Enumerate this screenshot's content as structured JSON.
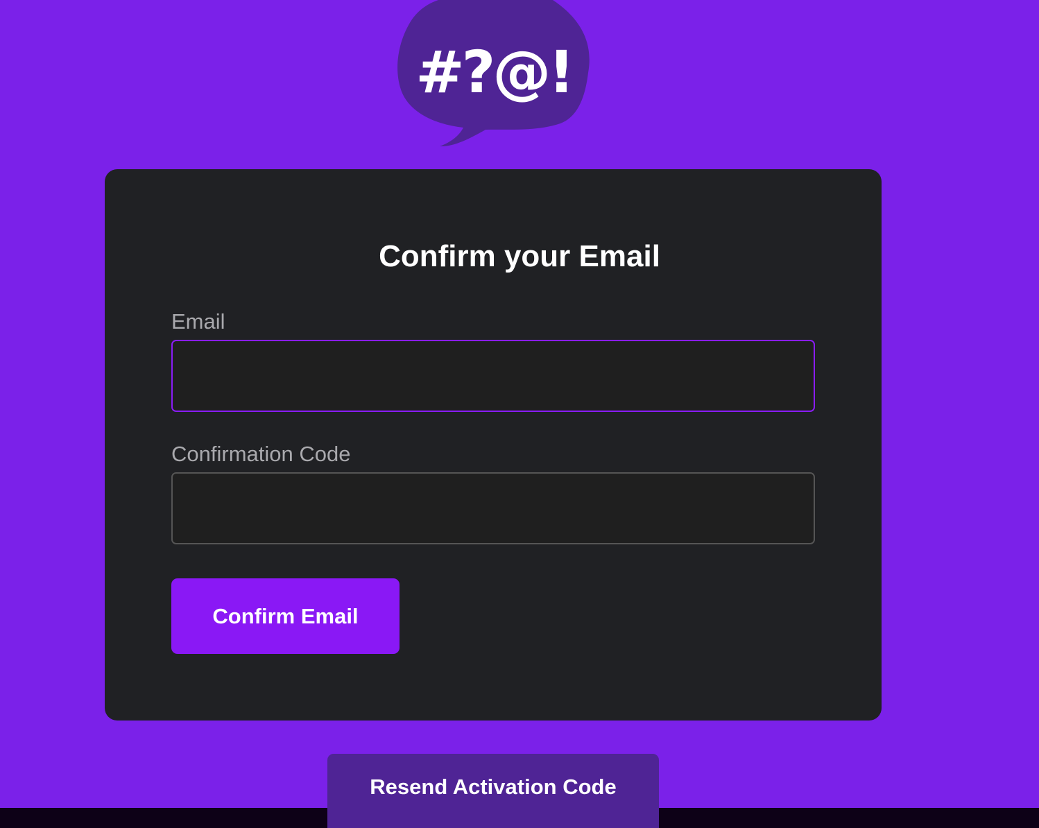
{
  "logo": {
    "icon": "speech-bubble-logo-icon",
    "glyphs": "#?@!",
    "bubble_color": "#4f2495",
    "glyph_color": "#ffffff"
  },
  "card": {
    "title": "Confirm your Email",
    "email": {
      "label": "Email",
      "value": "",
      "placeholder": ""
    },
    "confirmation_code": {
      "label": "Confirmation Code",
      "value": "",
      "placeholder": ""
    },
    "confirm_button_label": "Confirm Email"
  },
  "resend_button_label": "Resend Activation Code",
  "colors": {
    "page_background": "#7b21e9",
    "card_background": "#202124",
    "accent": "#8a18f5",
    "secondary_button": "#4f2495",
    "footer_bar": "#0d0117"
  }
}
